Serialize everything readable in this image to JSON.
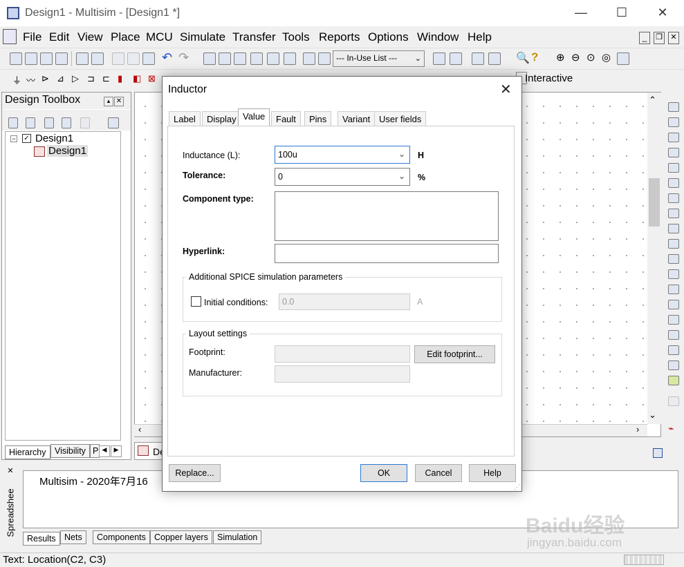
{
  "window": {
    "title": "Design1 - Multisim - [Design1 *]"
  },
  "menubar": [
    {
      "label": "File"
    },
    {
      "label": "Edit"
    },
    {
      "label": "View"
    },
    {
      "label": "Place"
    },
    {
      "label": "MCU"
    },
    {
      "label": "Simulate"
    },
    {
      "label": "Transfer"
    },
    {
      "label": "Tools"
    },
    {
      "label": "Reports"
    },
    {
      "label": "Options"
    },
    {
      "label": "Window"
    },
    {
      "label": "Help"
    }
  ],
  "toolbar": {
    "inuse_list": "--- In-Use List ---",
    "interactive_label": "Interactive"
  },
  "toolbox": {
    "title": "Design Toolbox",
    "tree": [
      {
        "label": "Design1"
      },
      {
        "label": "Design1"
      }
    ],
    "tabs": [
      "Hierarchy",
      "Visibility",
      "P"
    ]
  },
  "canvas_tab": "De",
  "spreadsheet": {
    "side_label": "Spreadshee",
    "message": "Multisim  -  2020年7月16",
    "tabs": [
      "Results",
      "Nets",
      "Components",
      "Copper layers",
      "Simulation"
    ]
  },
  "status": {
    "text": "Text: Location(C2, C3)"
  },
  "dialog": {
    "title": "Inductor",
    "tabs": [
      "Label",
      "Display",
      "Value",
      "Fault",
      "Pins",
      "Variant",
      "User fields"
    ],
    "active_tab": "Value",
    "inductance": {
      "label": "Inductance (L):",
      "value": "100u",
      "unit": "H"
    },
    "tolerance": {
      "label": "Tolerance:",
      "value": "0",
      "unit": "%"
    },
    "component_type": {
      "label": "Component type:",
      "value": ""
    },
    "hyperlink": {
      "label": "Hyperlink:",
      "value": ""
    },
    "spice": {
      "title": "Additional SPICE simulation parameters",
      "initial_label": "Initial conditions:",
      "initial_value": "0.0",
      "initial_unit": "A"
    },
    "layout": {
      "title": "Layout settings",
      "footprint_label": "Footprint:",
      "manufacturer_label": "Manufacturer:",
      "edit_footprint": "Edit footprint..."
    },
    "buttons": {
      "replace": "Replace...",
      "ok": "OK",
      "cancel": "Cancel",
      "help": "Help"
    }
  },
  "watermark": {
    "line1": "Baidu经验",
    "line2": "jingyan.baidu.com"
  }
}
